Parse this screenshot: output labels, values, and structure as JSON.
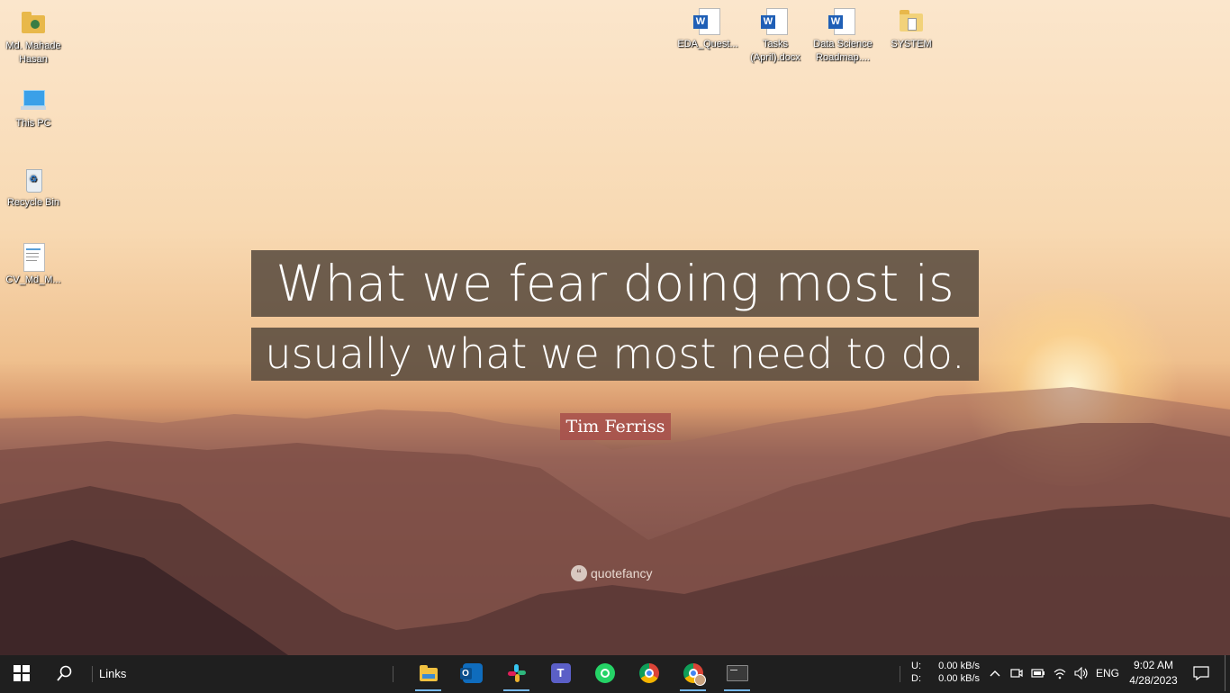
{
  "desktop_icons": {
    "user_folder": "Md. Mahade Hasan",
    "this_pc": "This PC",
    "recycle_bin": "Recycle Bin",
    "cv_doc": "CV_Md_M...",
    "eda_doc": "EDA_Quest...",
    "tasks_doc": "Tasks (April).docx",
    "roadmap_doc": "Data Science Roadmap....",
    "system_folder": "SYSTEM"
  },
  "wallpaper": {
    "quote_line1": "What we fear doing most is",
    "quote_line2": "usually what we most need to do.",
    "author": "Tim Ferriss",
    "watermark": "quotefancy"
  },
  "taskbar": {
    "links_label": "Links",
    "apps": [
      "File Explorer",
      "Outlook",
      "Slack",
      "Microsoft Teams",
      "WhatsApp",
      "Google Chrome",
      "Google Chrome (profile)",
      "Terminal"
    ],
    "net_upload_label": "U:",
    "net_upload_value": "0.00 kB/s",
    "net_download_label": "D:",
    "net_download_value": "0.00 kB/s",
    "language": "ENG",
    "time": "9:02 AM",
    "date": "4/28/2023"
  },
  "colors": {
    "taskbar_bg": "#1f1f1f",
    "active_indicator": "#76b9ed",
    "quote_bg": "#55483c",
    "author_bg": "#a8504b"
  }
}
